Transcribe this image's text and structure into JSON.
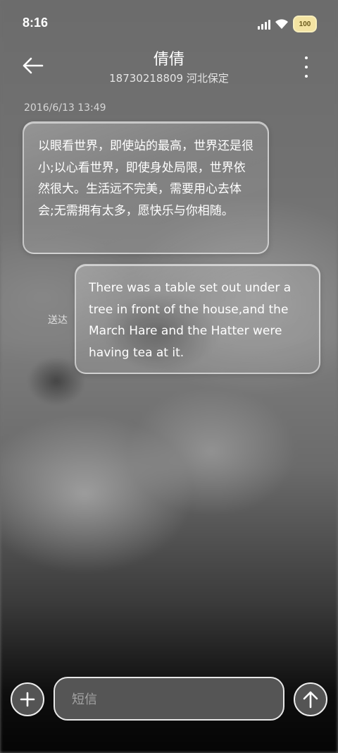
{
  "status_bar": {
    "time": "8:16",
    "battery_level": "100",
    "signal_icon": "cellular-signal-icon",
    "wifi_icon": "wifi-icon"
  },
  "header": {
    "back_icon": "arrow-left-icon",
    "contact_name": "倩倩",
    "contact_subtitle": "18730218809 河北保定",
    "more_icon": "more-vertical-icon"
  },
  "conversation": {
    "timestamp": "2016/6/13 13:49",
    "messages": [
      {
        "direction": "incoming",
        "text": "以眼看世界，即使站的最高，世界还是很小;以心看世界，即使身处局限，世界依然很大。生活远不完美，需要用心去体会;无需拥有太多，愿快乐与你相随。"
      },
      {
        "direction": "outgoing",
        "status": "送达",
        "text": "There was a table set out under a tree in front of the house,and the March Hare and the Hatter were having tea at it."
      }
    ]
  },
  "composer": {
    "add_icon": "plus-icon",
    "placeholder": "短信",
    "value": "",
    "send_icon": "arrow-up-icon"
  },
  "colors": {
    "text": "#ffffff",
    "bubble_border": "#e6e6e6",
    "battery_badge": "#f3e3a2"
  }
}
